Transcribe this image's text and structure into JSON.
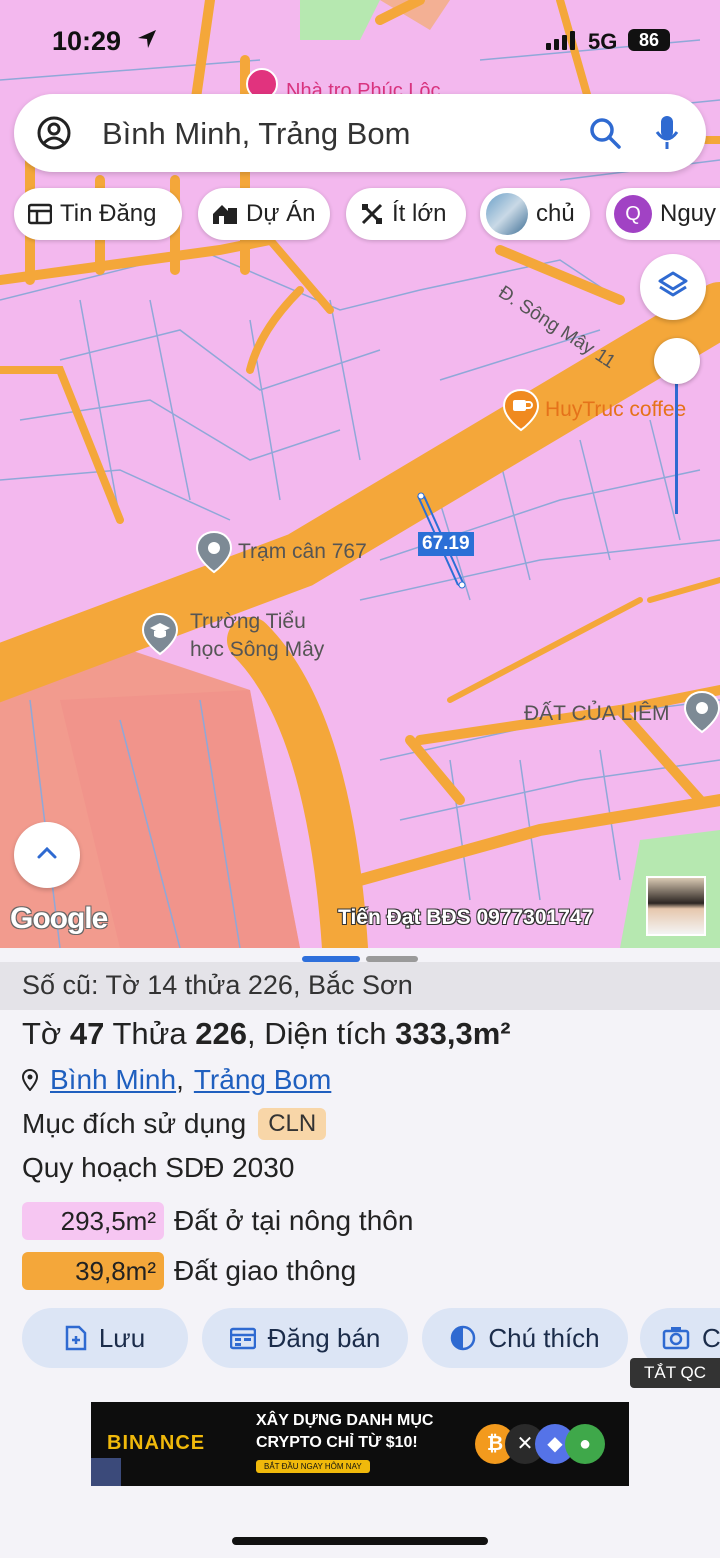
{
  "status_bar": {
    "time": "10:29",
    "network": "5G",
    "battery": "86"
  },
  "search": {
    "query": "Bình Minh, Trảng Bom"
  },
  "chips": [
    {
      "label": "Tin Đăng",
      "icon": "newspaper-icon"
    },
    {
      "label": "Dự Án",
      "icon": "building-icon"
    },
    {
      "label": "Ít lớn",
      "icon": "tools-icon"
    },
    {
      "label": "chủ",
      "icon": "avatar"
    },
    {
      "label": "Nguy",
      "avatar_letter": "Q"
    }
  ],
  "map": {
    "labels": {
      "street": "Đ. Sông Mây 11",
      "coffee": "HuyTruc coffee",
      "scale_station": "Trạm cân 767",
      "school_line1": "Trường Tiểu",
      "school_line2": "học Sông Mây",
      "land": "ĐẤT CỦA LIÊM",
      "lodging": "Nhà trọ Phúc Lộc",
      "measure": "67.19",
      "attribution": "Google",
      "watermark": "Tiến Đạt BĐS 0977301747"
    },
    "colors": {
      "residential": "#f3b8ee",
      "road": "#f4a73a",
      "boundary": "#8fa8d8",
      "forest": "#f29b8e"
    }
  },
  "sheet": {
    "old_record": "Số cũ: Tờ 14 thửa 226, Bắc Sơn",
    "title": {
      "to_label": "Tờ",
      "to_value": "47",
      "thua_label": "Thửa",
      "thua_value": "226",
      "area_label": ", Diện tích",
      "area_value": "333,3m²"
    },
    "location": {
      "ward": "Bình Minh",
      "separator": ",",
      "district": "Trảng Bom"
    },
    "purpose": {
      "label": "Mục đích sử dụng",
      "code": "CLN"
    },
    "plan_title": "Quy hoạch SDĐ 2030",
    "zones": [
      {
        "area": "293,5m²",
        "label": "Đất ở tại nông thôn",
        "color": "#f6c6f2"
      },
      {
        "area": "39,8m²",
        "label": "Đất giao thông",
        "color": "#f4a73a"
      }
    ],
    "actions": [
      {
        "label": "Lưu",
        "icon": "save-icon"
      },
      {
        "label": "Đăng bán",
        "icon": "calendar-icon"
      },
      {
        "label": "Chú thích",
        "icon": "contrast-icon"
      },
      {
        "label": "C",
        "icon": "camera-icon"
      }
    ],
    "close_ads": "TẮT QC"
  },
  "ad": {
    "brand": "BINANCE",
    "headline1": "XÂY DỰNG DANH MỤC",
    "headline2": "CRYPTO CHỈ TỪ $10!",
    "cta": "BẮT ĐẦU NGAY HÔM NAY"
  }
}
